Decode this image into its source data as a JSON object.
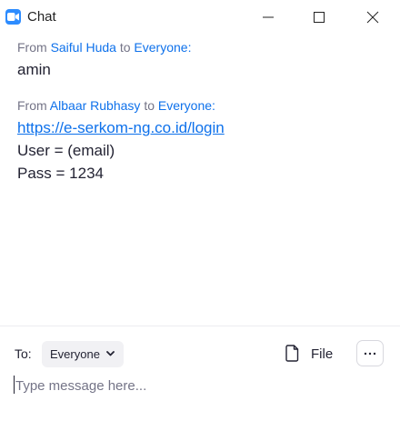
{
  "window": {
    "title": "Chat",
    "app_icon": "zoom-camera-icon",
    "controls": [
      "minimize-icon",
      "maximize-icon",
      "close-icon"
    ]
  },
  "messages": [
    {
      "from_prefix": "From",
      "sender": "Saiful Huda",
      "to_word": "to",
      "recipient": "Everyone:",
      "lines": [
        "amin"
      ]
    },
    {
      "from_prefix": "From",
      "sender": "Albaar Rubhasy",
      "to_word": "to",
      "recipient": "Everyone:",
      "link": "https://e-serkom-ng.co.id/login",
      "lines": [
        "User = (email)",
        "Pass = 1234"
      ]
    }
  ],
  "compose": {
    "to_label": "To:",
    "recipient_selected": "Everyone",
    "file_label": "File",
    "more_icon": "more-icon",
    "placeholder": "Type message here..."
  },
  "colors": {
    "accent": "#0e71eb",
    "muted": "#747487",
    "text": "#232333",
    "app_icon": "#2d8cff"
  }
}
